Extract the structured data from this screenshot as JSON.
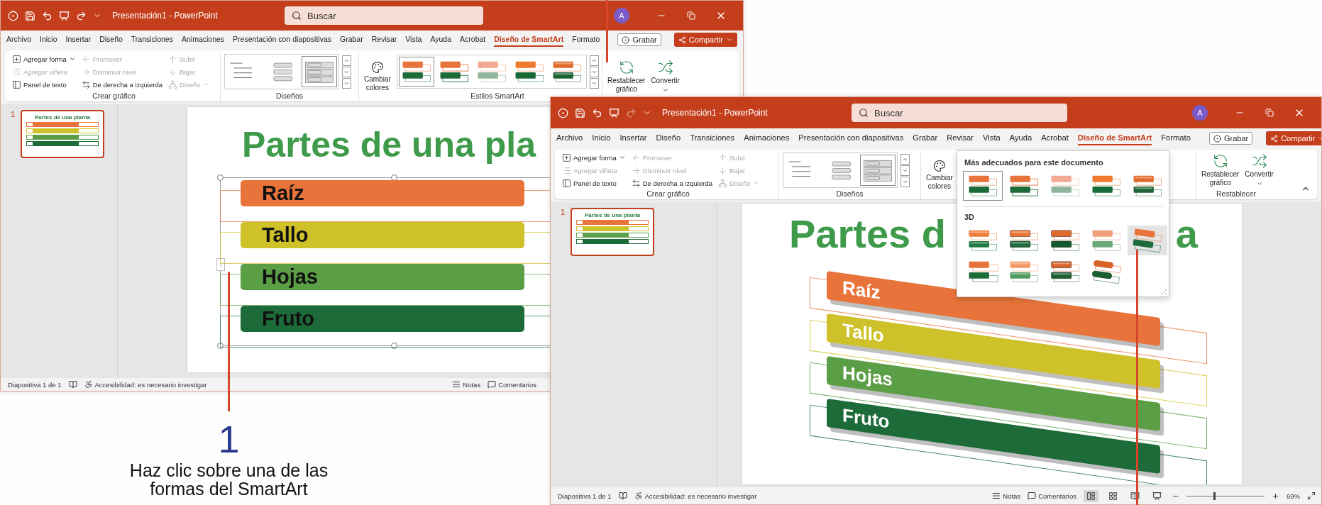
{
  "windows": [
    {
      "title": "Presentación1 - PowerPoint",
      "redo_disabled": false,
      "search": {
        "placeholder": "Buscar"
      },
      "avatar": "A",
      "tabs": [
        {
          "label": "Archivo",
          "selected": false
        },
        {
          "label": "Inicio",
          "selected": false
        },
        {
          "label": "Insertar",
          "selected": false
        },
        {
          "label": "Diseño",
          "selected": false
        },
        {
          "label": "Transiciones",
          "selected": false
        },
        {
          "label": "Animaciones",
          "selected": false
        },
        {
          "label": "Presentación con diapositivas",
          "selected": false
        },
        {
          "label": "Grabar",
          "selected": false
        },
        {
          "label": "Revisar",
          "selected": false
        },
        {
          "label": "Vista",
          "selected": false
        },
        {
          "label": "Ayuda",
          "selected": false
        },
        {
          "label": "Acrobat",
          "selected": false
        },
        {
          "label": "Diseño de SmartArt",
          "selected": true
        },
        {
          "label": "Formato",
          "selected": false
        }
      ],
      "record_button": "Grabar",
      "share_button": "Compartir",
      "ribbon": {
        "create": {
          "label": "Crear gráfico",
          "commands": [
            {
              "label": "Agregar forma",
              "disabled": false,
              "dropdown": true
            },
            {
              "label": "Promover",
              "disabled": true,
              "dropdown": false
            },
            {
              "label": "Subir",
              "disabled": true,
              "dropdown": false
            },
            {
              "label": "Agregar viñeta",
              "disabled": true,
              "dropdown": false
            },
            {
              "label": "Disminuir nivel",
              "disabled": true,
              "dropdown": false
            },
            {
              "label": "Bajar",
              "disabled": true,
              "dropdown": false
            },
            {
              "label": "Panel de texto",
              "disabled": false,
              "dropdown": false
            },
            {
              "label": "De derecha a izquierda",
              "disabled": false,
              "dropdown": false
            },
            {
              "label": "Diseño",
              "disabled": true,
              "dropdown": true
            }
          ]
        },
        "layouts": {
          "label": "Diseños",
          "items": [
            {
              "selected": false
            },
            {
              "selected": false
            },
            {
              "selected": true
            }
          ]
        },
        "colors": {
          "label": "Cambiar colores"
        },
        "styles": {
          "label": "Estilos SmartArt",
          "items": [
            {
              "kind": "flat",
              "selected": true
            },
            {
              "kind": "flat-outline",
              "selected": false
            },
            {
              "kind": "pale",
              "selected": false
            },
            {
              "kind": "bold",
              "selected": false
            },
            {
              "kind": "shaded",
              "selected": false
            }
          ]
        },
        "reset": {
          "buttons": [
            {
              "label": "Restablecer gráfico",
              "dropdown": false
            },
            {
              "label": "Convertir",
              "dropdown": true
            }
          ]
        }
      },
      "slide_panel": [
        {
          "number": "1",
          "title": "Partes de una planta",
          "selected": true
        }
      ],
      "slide": {
        "kind": "flat",
        "selected": true,
        "title_parts": [
          "Partes de una pla"
        ],
        "shapes": [
          {
            "label": "Raíz",
            "color": "#e8743b"
          },
          {
            "label": "Tallo",
            "color": "#cfc12a"
          },
          {
            "label": "Hojas",
            "color": "#5a9e45"
          },
          {
            "label": "Fruto",
            "color": "#1e6b3a"
          }
        ]
      },
      "status_bar": {
        "slide": "Diapositiva 1 de 1",
        "accessibility": "Accesibilidad: es necesario investigar",
        "notes": "Notas",
        "comments": "Comentarios"
      }
    },
    {
      "title": "Presentación1 - PowerPoint",
      "redo_disabled": true,
      "search": {
        "placeholder": "Buscar"
      },
      "avatar": "A",
      "tabs": [
        {
          "label": "Archivo",
          "selected": false
        },
        {
          "label": "Inicio",
          "selected": false
        },
        {
          "label": "Insertar",
          "selected": false
        },
        {
          "label": "Diseño",
          "selected": false
        },
        {
          "label": "Transiciones",
          "selected": false
        },
        {
          "label": "Animaciones",
          "selected": false
        },
        {
          "label": "Presentación con diapositivas",
          "selected": false
        },
        {
          "label": "Grabar",
          "selected": false
        },
        {
          "label": "Revisar",
          "selected": false
        },
        {
          "label": "Vista",
          "selected": false
        },
        {
          "label": "Ayuda",
          "selected": false
        },
        {
          "label": "Acrobat",
          "selected": false
        },
        {
          "label": "Diseño de SmartArt",
          "selected": true
        },
        {
          "label": "Formato",
          "selected": false
        }
      ],
      "record_button": "Grabar",
      "share_button": "Compartir",
      "ribbon": {
        "create": {
          "label": "Crear gráfico",
          "commands": [
            {
              "label": "Agregar forma",
              "disabled": false,
              "dropdown": true
            },
            {
              "label": "Promover",
              "disabled": true,
              "dropdown": false
            },
            {
              "label": "Subir",
              "disabled": true,
              "dropdown": false
            },
            {
              "label": "Agregar viñeta",
              "disabled": true,
              "dropdown": false
            },
            {
              "label": "Disminuir nivel",
              "disabled": true,
              "dropdown": false
            },
            {
              "label": "Bajar",
              "disabled": true,
              "dropdown": false
            },
            {
              "label": "Panel de texto",
              "disabled": false,
              "dropdown": false
            },
            {
              "label": "De derecha a izquierda",
              "disabled": false,
              "dropdown": false
            },
            {
              "label": "Diseño",
              "disabled": true,
              "dropdown": true
            }
          ]
        },
        "layouts": {
          "label": "Diseños",
          "items": [
            {
              "selected": false
            },
            {
              "selected": false
            },
            {
              "selected": true
            }
          ]
        },
        "colors": {
          "label": "Cambiar colores"
        },
        "style_gallery": {
          "sections": [
            {
              "title": "Más adecuados para este documento",
              "items": [
                {
                  "kind": "flat",
                  "selected": true,
                  "highlighted": false
                },
                {
                  "kind": "flat-outline",
                  "selected": false,
                  "highlighted": false
                },
                {
                  "kind": "pale",
                  "selected": false,
                  "highlighted": false
                },
                {
                  "kind": "bold",
                  "selected": false,
                  "highlighted": false
                },
                {
                  "kind": "shaded",
                  "selected": false,
                  "highlighted": false
                }
              ]
            },
            {
              "title": "3D",
              "items": [
                {
                  "kind": "raised",
                  "selected": false,
                  "highlighted": false
                },
                {
                  "kind": "bevel",
                  "selected": false,
                  "highlighted": false
                },
                {
                  "kind": "framed",
                  "selected": false,
                  "highlighted": false
                },
                {
                  "kind": "faded",
                  "selected": false,
                  "highlighted": false
                },
                {
                  "kind": "perspective",
                  "selected": false,
                  "highlighted": true
                },
                {
                  "kind": "offset",
                  "selected": false,
                  "highlighted": false
                },
                {
                  "kind": "light-bevel",
                  "selected": false,
                  "highlighted": false
                },
                {
                  "kind": "polished",
                  "selected": false,
                  "highlighted": false
                },
                {
                  "kind": "cylinder",
                  "selected": false,
                  "highlighted": false
                }
              ]
            }
          ]
        },
        "reset": {
          "label": "Restablecer",
          "buttons": [
            {
              "label": "Restablecer gráfico",
              "dropdown": false
            },
            {
              "label": "Convertir",
              "dropdown": true
            }
          ]
        },
        "show_collapse": true
      },
      "slide_panel": [
        {
          "number": "1",
          "title": "Partes de una planta",
          "selected": true
        }
      ],
      "slide": {
        "kind": "perspective",
        "title_parts": [
          "Partes d",
          "a"
        ],
        "shapes": [
          {
            "label": "Raíz",
            "color": "#e8743b"
          },
          {
            "label": "Tallo",
            "color": "#cfc12a"
          },
          {
            "label": "Hojas",
            "color": "#5a9e45"
          },
          {
            "label": "Fruto",
            "color": "#1e6b3a"
          }
        ]
      },
      "status_bar": {
        "slide": "Diapositiva 1 de 1",
        "accessibility": "Accesibilidad: es necesario investigar",
        "notes": "Notas",
        "comments": "Comentarios",
        "views": [
          {
            "selected": true
          },
          {
            "selected": false
          },
          {
            "selected": false
          },
          {
            "selected": false
          }
        ],
        "zoom": {
          "level": 0.35,
          "reading": "69%"
        }
      }
    }
  ],
  "annotation": {
    "step": "1",
    "caption": "Haz clic sobre una de las formas del SmartArt"
  }
}
